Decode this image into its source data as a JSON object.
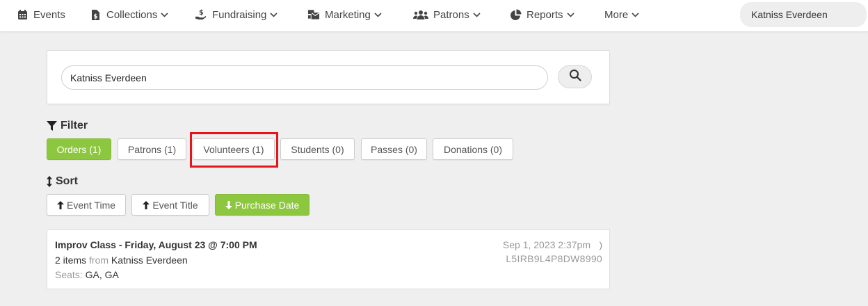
{
  "nav": {
    "items": [
      {
        "label": "Events",
        "icon": "calendar-icon",
        "dropdown": false
      },
      {
        "label": "Collections",
        "icon": "file-dollar-icon",
        "dropdown": true
      },
      {
        "label": "Fundraising",
        "icon": "hand-holding-dollar-icon",
        "dropdown": true
      },
      {
        "label": "Marketing",
        "icon": "mail-bulk-icon",
        "dropdown": true
      },
      {
        "label": "Patrons",
        "icon": "users-icon",
        "dropdown": true
      },
      {
        "label": "Reports",
        "icon": "pie-chart-icon",
        "dropdown": true
      },
      {
        "label": "More",
        "icon": "",
        "dropdown": true
      }
    ],
    "search_value": "Katniss Everdeen"
  },
  "search": {
    "value": "Katniss Everdeen"
  },
  "filter": {
    "heading": "Filter",
    "options": [
      {
        "label": "Orders (1)",
        "active": true
      },
      {
        "label": "Patrons (1)",
        "active": false
      },
      {
        "label": "Volunteers (1)",
        "active": false,
        "highlighted": true
      },
      {
        "label": "Students (0)",
        "active": false
      },
      {
        "label": "Passes (0)",
        "active": false
      },
      {
        "label": "Donations (0)",
        "active": false
      }
    ]
  },
  "sort": {
    "heading": "Sort",
    "options": [
      {
        "label": "Event Time",
        "direction": "up",
        "active": false
      },
      {
        "label": "Event Title",
        "direction": "up",
        "active": false
      },
      {
        "label": "Purchase Date",
        "direction": "down",
        "active": true
      }
    ]
  },
  "orders": [
    {
      "title": "Improv Class - Friday, August 23 @ 7:00 PM",
      "item_count": "2 items",
      "from_label": "from",
      "patron": "Katniss Everdeen",
      "seats_label": "Seats:",
      "seats": "GA, GA",
      "date": "Sep 1, 2023 2:37pm",
      "code": "L5IRB9L4P8DW8990",
      "arrow": ")"
    }
  ],
  "colors": {
    "accent": "#8dc63f",
    "highlight": "#e3161b",
    "background": "#efefef"
  }
}
